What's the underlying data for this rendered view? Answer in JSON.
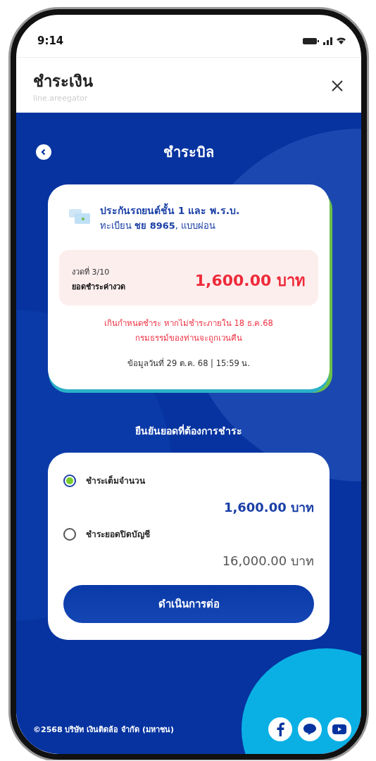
{
  "status_bar": {
    "time": "9:14"
  },
  "header": {
    "title": "ชำระเงิน",
    "subtitle": "line.areegator"
  },
  "page": {
    "title": "ชำระบิล"
  },
  "bill_card": {
    "title": "ประกันรถยนต์ชั้น 1 และ พ.ร.บ.",
    "subtitle": "ทะเบียน **ชย 8965**, แบบผ่อน",
    "installment": "งวดที่ 3/10",
    "amount_label": "ยอดชำระค่างวด",
    "amount": "1,600.00 บาท",
    "warning": [
      "เกินกำหนดชำระ หากไม่ชำระภายใน 18 ธ.ค.68",
      "กรมธรรม์ของท่านจะถูกเวนคืน"
    ],
    "updated": "ข้อมูลวันที่ 29 ต.ค. 68 | 15:59 น."
  },
  "confirm_title": "ยืนยันยอดที่ต้องการชำระ",
  "options": [
    {
      "label": "ชำระเต็มจำนวน",
      "amount": "1,600.00 บาท",
      "selected": true
    },
    {
      "label": "ชำระยอดปิดบัญชี",
      "amount": "16,000.00 บาท",
      "selected": false
    }
  ],
  "continue_button": "ดำเนินการต่อ",
  "footer": {
    "copyright": "©2568 บริษัท เงินติดล้อ จำกัด (มหาชน)"
  }
}
